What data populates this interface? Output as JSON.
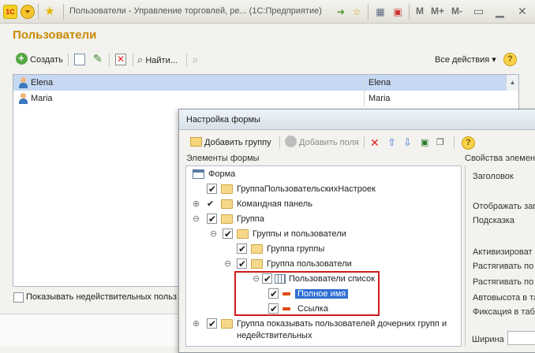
{
  "titlebar": {
    "logo": "1С",
    "title": "Пользователи - Управление торговлей, ре... (1С:Предприятие)",
    "m_labels": [
      "M",
      "M+",
      "M-"
    ]
  },
  "main": {
    "title": "Пользователи",
    "toolbar": {
      "create": "Создать",
      "find": "Найти...",
      "all_actions": "Все действия ▾",
      "help": "?"
    },
    "rows": [
      {
        "name": "Elena",
        "full_name": "Elena",
        "selected": true
      },
      {
        "name": "Maria",
        "full_name": "Maria",
        "selected": false
      }
    ],
    "show_invalid_label": "Показывать недействительных польз"
  },
  "dialog": {
    "title": "Настройка формы",
    "toolbar": {
      "add_group": "Добавить группу",
      "add_fields": "Добавить поля",
      "help": "?"
    },
    "elements_label": "Элементы формы",
    "properties_label": "Свойства элемент",
    "tree": [
      {
        "label": "Форма"
      },
      {
        "label": "ГруппаПользовательскихНастроек"
      },
      {
        "label": "Командная панель"
      },
      {
        "label": "Группа"
      },
      {
        "label": "Группы и пользователи"
      },
      {
        "label": "Группа группы"
      },
      {
        "label": "Группа пользователи"
      },
      {
        "label": "Пользователи список"
      },
      {
        "label": "Полное имя"
      },
      {
        "label": "Ссылка"
      },
      {
        "label": "Группа показывать пользователей дочерних групп и"
      },
      {
        "label": "недействительных"
      }
    ],
    "properties": [
      "Заголовок",
      "Отображать заг",
      "Подсказка",
      "Активизироват",
      "Растягивать по",
      "Растягивать по",
      "Автовысота в та",
      "Фиксация в таб",
      "Ширина"
    ]
  },
  "colors": {
    "title_accent": "#c88a00",
    "selection": "#c6d8f2",
    "tree_selection": "#2f6fd3",
    "highlight_box": "#d01b1b"
  }
}
